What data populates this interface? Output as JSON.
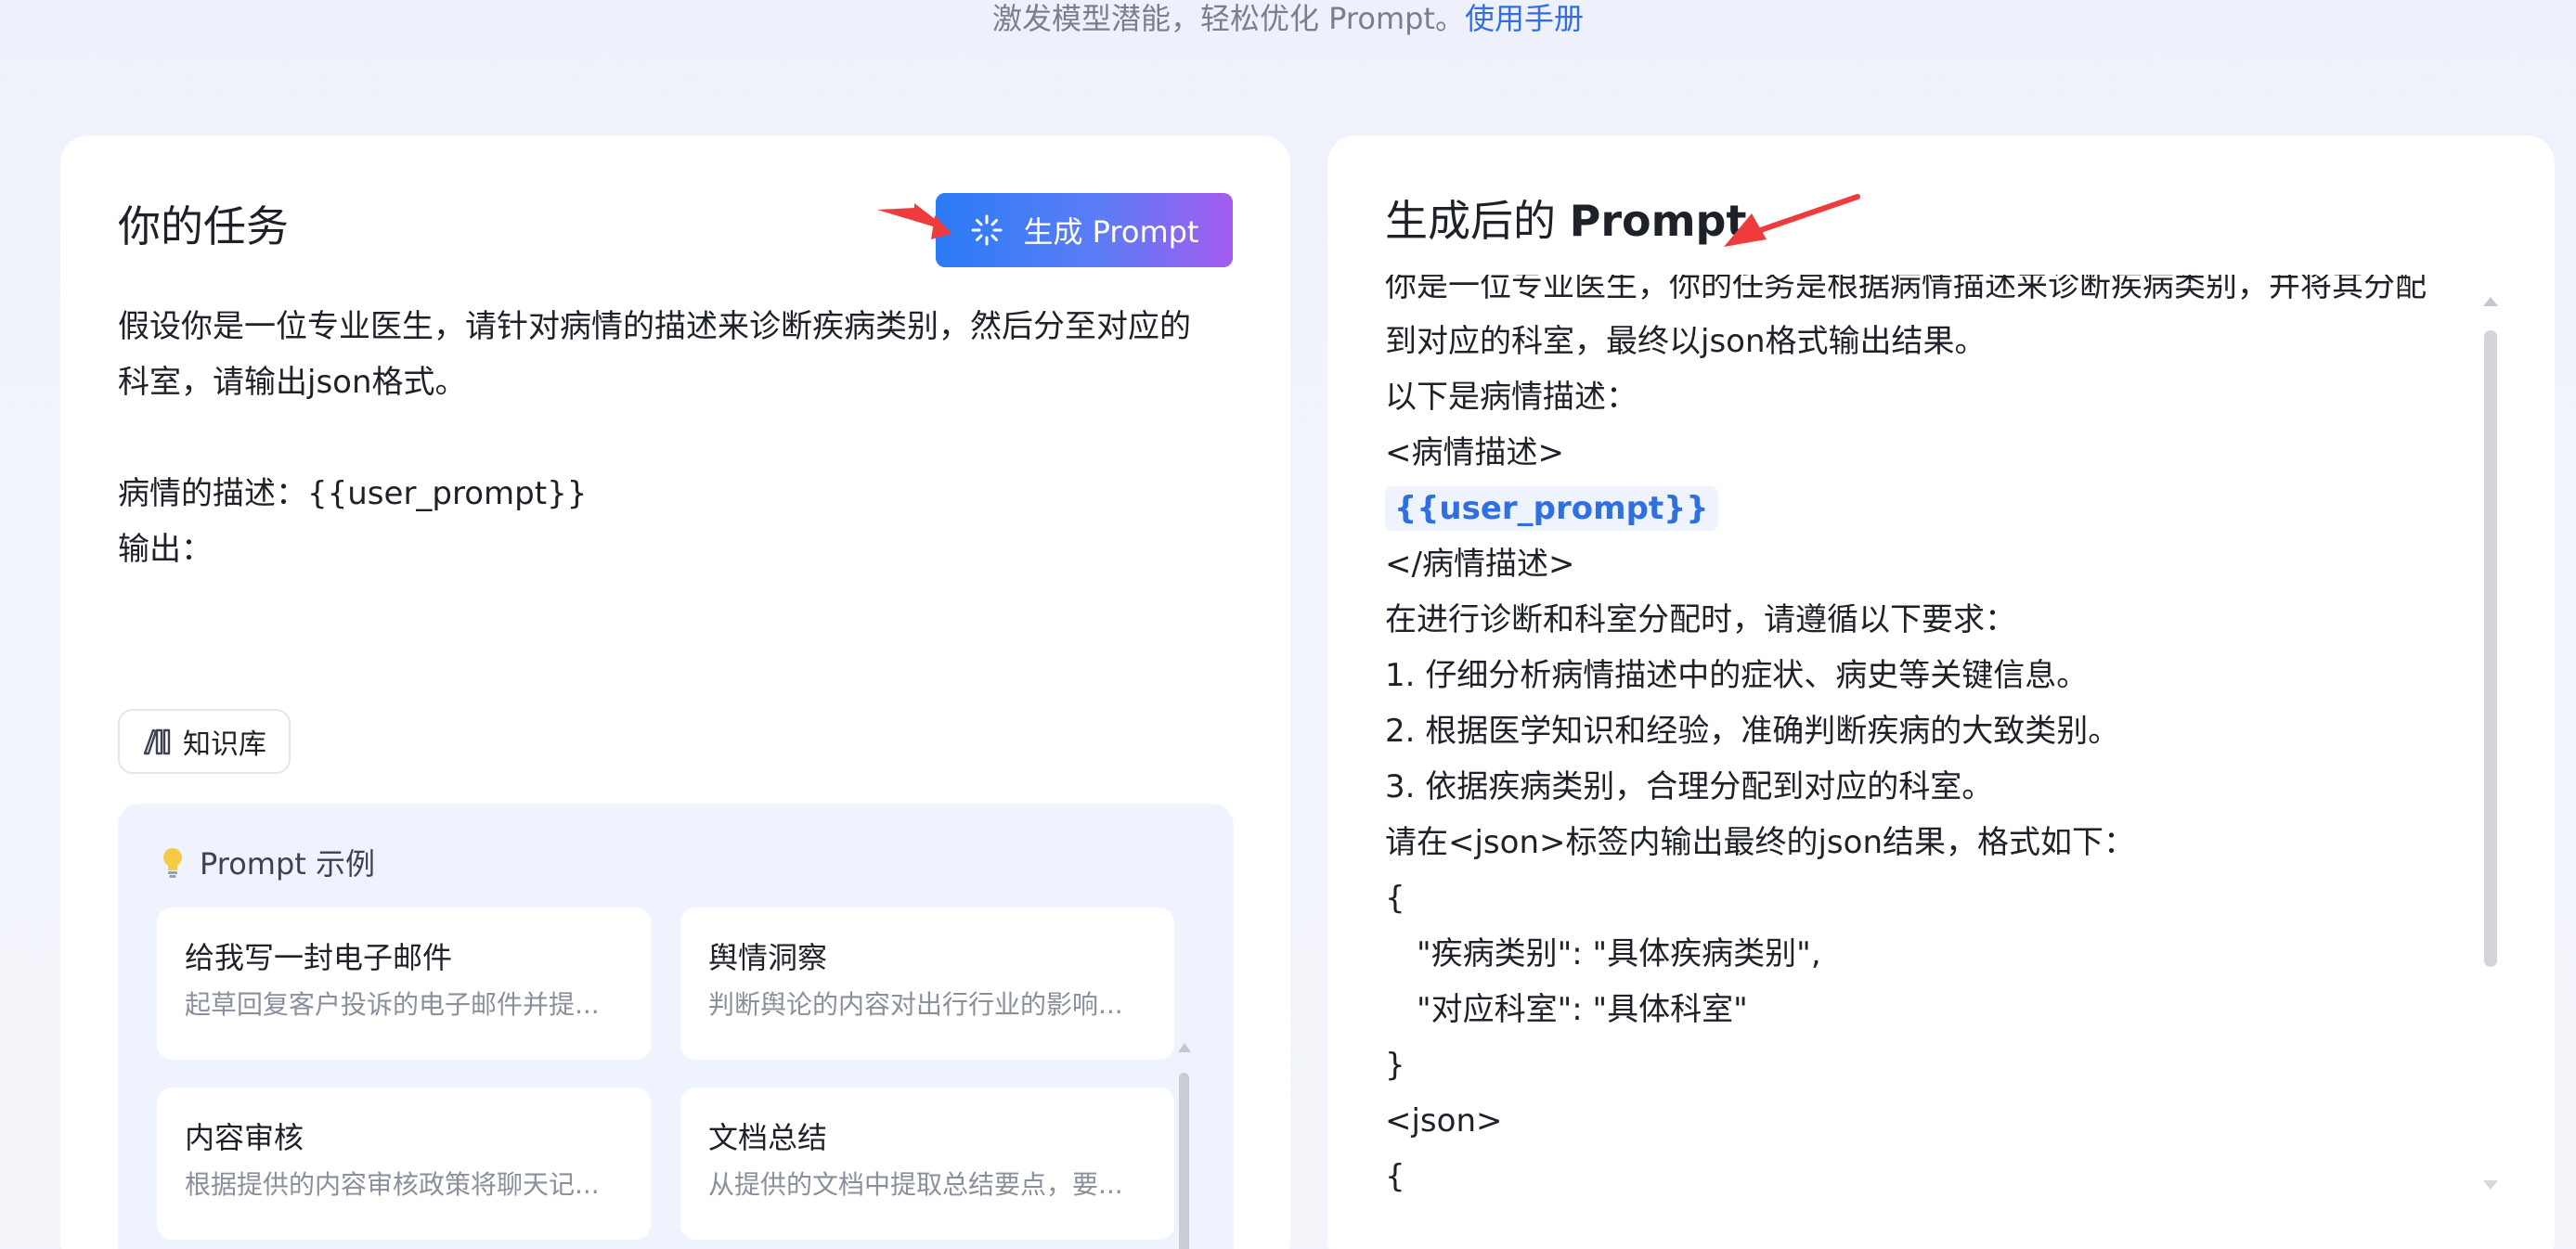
{
  "header": {
    "tagline": "激发模型潜能，轻松优化 Prompt。",
    "manual_link": "使用手册"
  },
  "task_panel": {
    "title": "你的任务",
    "generate_button_label": "生成 Prompt",
    "task_text": "假设你是一位专业医生，请针对病情的描述来诊断疾病类别，然后分至对应的\n科室，请输出json格式。\n\n病情的描述：{{user_prompt}}\n输出：",
    "knowledge_base_label": "知识库",
    "examples_title": "Prompt 示例",
    "examples": [
      {
        "title": "给我写一封电子邮件",
        "desc": "起草回复客户投诉的电子邮件并提..."
      },
      {
        "title": "舆情洞察",
        "desc": "判断舆论的内容对出行行业的影响..."
      },
      {
        "title": "内容审核",
        "desc": "根据提供的内容审核政策将聊天记..."
      },
      {
        "title": "文档总结",
        "desc": "从提供的文档中提取总结要点，要..."
      }
    ]
  },
  "result_panel": {
    "title_prefix": "生成后的 ",
    "title_bold": "Prompt",
    "lines": [
      "你是一位专业医生，你的任务是根据病情描述来诊断疾病类别，并将其分配",
      "到对应的科室，最终以json格式输出结果。",
      "以下是病情描述：",
      "<病情描述>",
      "{{user_prompt}}",
      "</病情描述>",
      "在进行诊断和科室分配时，请遵循以下要求：",
      "1. 仔细分析病情描述中的症状、病史等关键信息。",
      "2. 根据医学知识和经验，准确判断疾病的大致类别。",
      "3. 依据疾病类别，合理分配到对应的科室。",
      "请在<json>标签内输出最终的json结果，格式如下：",
      "{",
      "\"疾病类别\": \"具体疾病类别\",",
      "\"对应科室\": \"具体科室\"",
      "}",
      "<json>",
      "{"
    ]
  },
  "colors": {
    "accent_blue": "#2f6fe0",
    "button_gradient_start": "#2b7bf6",
    "button_gradient_end": "#a45cf0",
    "annotation_red": "#ee3b3b"
  }
}
